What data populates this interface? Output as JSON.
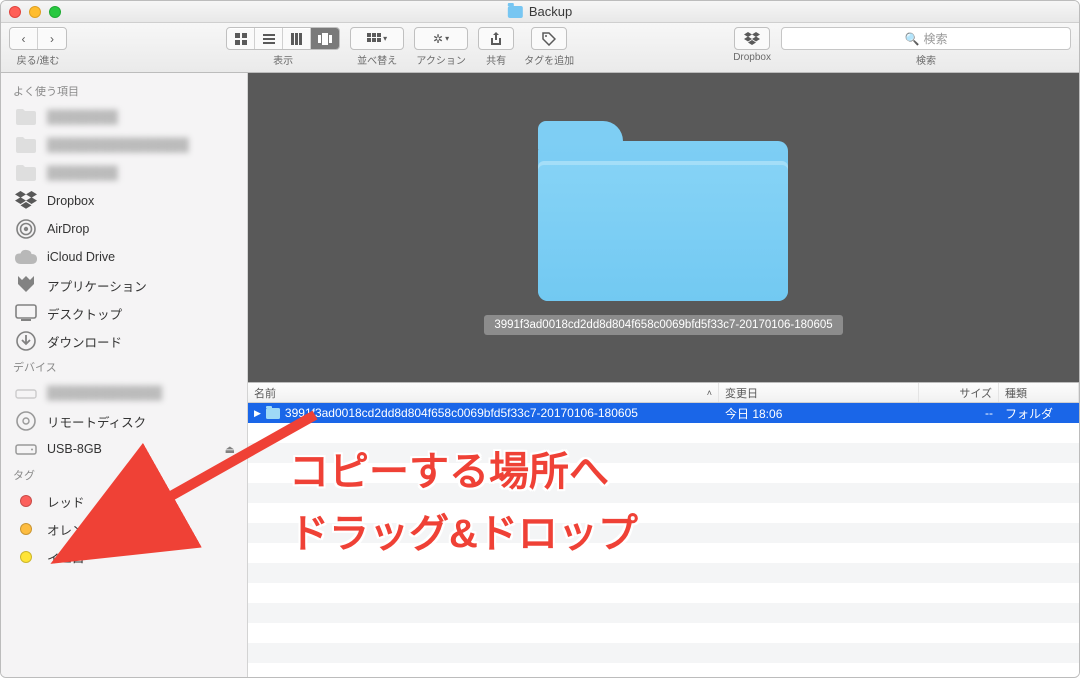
{
  "window": {
    "title": "Backup"
  },
  "toolbar": {
    "nav_label": "戻る/進む",
    "view_label": "表示",
    "sort_label": "並べ替え",
    "action_label": "アクション",
    "share_label": "共有",
    "tag_label": "タグを追加",
    "dropbox_label": "Dropbox",
    "search_label": "検索",
    "search_placeholder": "検索"
  },
  "sidebar": {
    "favorites_header": "よく使う項目",
    "items": [
      {
        "name": "blurred1",
        "label": "████████",
        "icon": "folder",
        "blur": true
      },
      {
        "name": "blurred2",
        "label": "████████████████",
        "icon": "folder",
        "blur": true
      },
      {
        "name": "blurred3",
        "label": "████████",
        "icon": "folder",
        "blur": true
      },
      {
        "name": "dropbox",
        "label": "Dropbox",
        "icon": "dropbox"
      },
      {
        "name": "airdrop",
        "label": "AirDrop",
        "icon": "airdrop"
      },
      {
        "name": "icloud",
        "label": "iCloud Drive",
        "icon": "cloud"
      },
      {
        "name": "applications",
        "label": "アプリケーション",
        "icon": "apps"
      },
      {
        "name": "desktop",
        "label": "デスクトップ",
        "icon": "desktop"
      },
      {
        "name": "downloads",
        "label": "ダウンロード",
        "icon": "downloads"
      }
    ],
    "devices_header": "デバイス",
    "devices": [
      {
        "name": "device-blurred",
        "label": "█████████████",
        "icon": "machd",
        "blur": true
      },
      {
        "name": "remote-disc",
        "label": "リモートディスク",
        "icon": "disc"
      },
      {
        "name": "usb-8gb",
        "label": "USB-8GB",
        "icon": "external",
        "eject": true
      }
    ],
    "tags_header": "タグ",
    "tags": [
      {
        "name": "red",
        "label": "レッド",
        "color": "red"
      },
      {
        "name": "orange",
        "label": "オレンジ",
        "color": "orange"
      },
      {
        "name": "yellow",
        "label": "イエロー",
        "color": "yellow"
      }
    ]
  },
  "preview": {
    "caption": "3991f3ad0018cd2dd8d804f658c0069bfd5f33c7-20170106-180605"
  },
  "list": {
    "headers": {
      "name": "名前",
      "modified": "変更日",
      "size": "サイズ",
      "kind": "種類"
    },
    "rows": [
      {
        "name": "3991f3ad0018cd2dd8d804f658c0069bfd5f33c7-20170106-180605",
        "modified": "今日 18:06",
        "size": "--",
        "kind": "フォルダ"
      }
    ]
  },
  "annotation": {
    "line1": "コピーする場所へ",
    "line2": "ドラッグ&ドロップ"
  }
}
